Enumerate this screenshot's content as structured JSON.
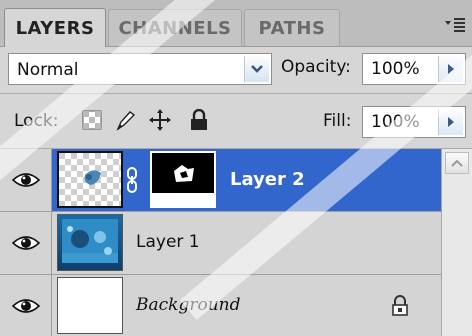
{
  "tabs": [
    {
      "label": "LAYERS",
      "active": true
    },
    {
      "label": "CHANNELS",
      "active": false
    },
    {
      "label": "PATHS",
      "active": false
    }
  ],
  "panel_menu_icon": "panel-menu-icon",
  "blend_mode": {
    "value": "Normal"
  },
  "opacity": {
    "label": "Opacity:",
    "value": "100%"
  },
  "lock": {
    "label": "Lock:",
    "icons": [
      "lock-transparent-pixels-icon",
      "lock-image-pixels-icon",
      "lock-position-icon",
      "lock-all-icon"
    ]
  },
  "fill": {
    "label": "Fill:",
    "value": "100%"
  },
  "layers": [
    {
      "name": "Layer 2",
      "visible": true,
      "selected": true,
      "has_mask": true
    },
    {
      "name": "Layer 1",
      "visible": true,
      "selected": false,
      "has_mask": false
    },
    {
      "name": "Background",
      "visible": true,
      "selected": false,
      "locked": true
    }
  ],
  "colors": {
    "selection": "#3366cc",
    "panel_bg": "#d6d6d6",
    "tabbar_bg": "#bdbdbd"
  }
}
